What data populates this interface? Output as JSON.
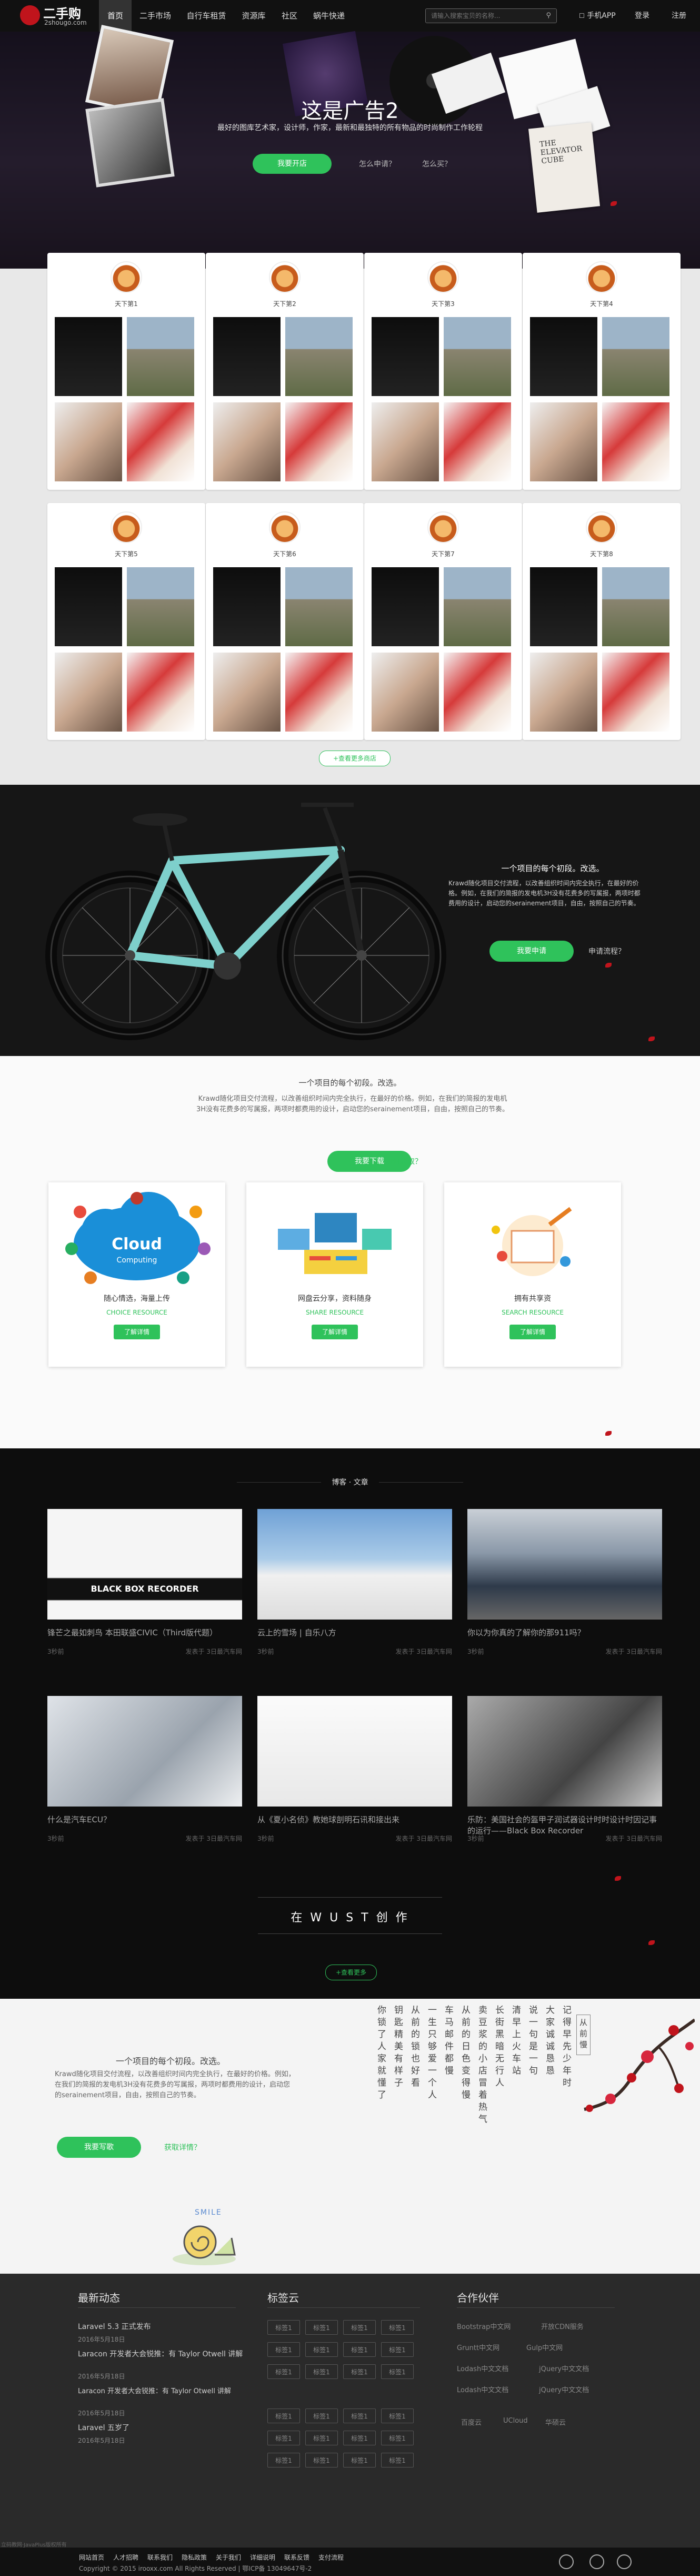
{
  "nav": {
    "logo_text": "二手购",
    "logo_sub": "2shougo.com",
    "items": [
      {
        "label": "首页"
      },
      {
        "label": "二手市场"
      },
      {
        "label": "自行车租赁"
      },
      {
        "label": "资源库"
      },
      {
        "label": "社区"
      },
      {
        "label": "蜗牛快递"
      }
    ],
    "search_placeholder": "请输入搜索宝贝的名称...",
    "app_label": "手机APP",
    "login_label": "登录",
    "register_label": "注册"
  },
  "hero": {
    "title": "这是广告2",
    "desc": "最好的图库艺术家，设计师，作家，最新和最独特的所有物品的时尚制作工作轮程",
    "open_button": "我要开店",
    "link_apply": "怎么申请？",
    "link_buy": "怎么买？",
    "book_text": "THE ELEVATOR CUBE"
  },
  "cards": [
    {
      "name": "天下第1"
    },
    {
      "name": "天下第2"
    },
    {
      "name": "天下第3"
    },
    {
      "name": "天下第4"
    },
    {
      "name": "天下第5"
    },
    {
      "name": "天下第6"
    },
    {
      "name": "天下第7"
    },
    {
      "name": "天下第8"
    }
  ],
  "cards_more": "+查看更多商店",
  "bike": {
    "title": "一个项目的每个初段。改选。",
    "desc": "Krawd随化项目交付流程，以改善组织时间内完全执行，在最好的价格。例如，在我们的简报的发电机3H没有花费多的写属报，两项时都费用的设计，启动您的serainement项目，自由，按照自己的节奏。",
    "apply_button": "我要申请",
    "link_process": "申请流程？"
  },
  "intro": {
    "title": "一个项目的每个初段。改选。",
    "desc": "Krawd随化项目交付流程，以改善组织时间内完全执行，在最好的价格。例如，在我们的简报的发电机3H没有花费多的写属报，两项时都费用的设计，启动您的serainement项目，自由，按照自己的节奏。",
    "download_button": "我要下载",
    "link_how": "如何获取？"
  },
  "resources": [
    {
      "cloud_word": "Cloud",
      "cloud_sub": "Computing",
      "title": "随心情选，海量上传",
      "sub": "CHOICE RESOURCE",
      "button": "了解详情"
    },
    {
      "title": "网盘云分享，资料随身",
      "sub": "SHARE RESOURCE",
      "button": "了解详情"
    },
    {
      "title": "拥有共享资",
      "sub": "SEARCH RESOURCE",
      "button": "了解详情"
    }
  ],
  "blog": {
    "header": "博客 · 文章",
    "posts": [
      {
        "title": "锋芒之最如刺鸟 本田联盛CIVIC（Third版代题）",
        "meta": "3秒前",
        "author": "发表于 3日最汽车网",
        "img_text": "BLACK BOX RECORDER"
      },
      {
        "title": "云上的雪场 | 自乐八方",
        "meta": "3秒前",
        "author": "发表于 3日最汽车网"
      },
      {
        "title": "你以为你真的了解你的那911吗？",
        "meta": "3秒前",
        "author": "发表于 3日最汽车网"
      },
      {
        "title": "什么是汽车ECU？",
        "meta": "3秒前",
        "author": "发表于 3日最汽车网"
      },
      {
        "title": "从《夏小名侦》教她球剖明石讯和接出来",
        "meta": "3秒前",
        "author": "发表于 3日最汽车网"
      },
      {
        "title": "乐防：美国社会的盔甲子润试器设计时时设计时因记事的运行——Black Box Recorder",
        "meta": "3秒前",
        "author": "发表于 3日最汽车网"
      }
    ],
    "banner": "在 W U S T 创 作",
    "more": "+查看更多"
  },
  "poem": {
    "title": "一个项目的每个初段。改选。",
    "desc": "Krawd随化项目交付流程，以改善组织时间内完全执行，在最好的价格。例如，在我们的简报的发电机3H没有花费多的写属报，两项时都费用的设计，启动您的serainement项目，自由，按照自己的节奏。",
    "button": "我要写歌",
    "link": "获取详情？",
    "cols": [
      "从前慢",
      "记得早先少年时",
      "大家诚诚恳恳",
      "说一句是一句",
      "清早上火车站",
      "长街黑暗无行人",
      "卖豆浆的小店冒着热气",
      "从前的日色变得慢",
      "车马邮件都慢",
      "一生只够爱一个人",
      "从前的锁也好看",
      "钥匙精美有样子",
      "你锁了人家就懂了"
    ],
    "snail_text": "SMILE"
  },
  "footer": {
    "news_title": "最新动态",
    "news": [
      {
        "title": "Laravel 5.3 正式发布",
        "date": "2016年5月18日"
      },
      {
        "title": "Laracon 开发者大会锐推：有 Taylor Otwell 讲解",
        "date": "2016年5月18日"
      },
      {
        "title": "Laracon 开发者大会锐推：有 Taylor Otwell 讲解",
        "date": "2016年5月18日"
      },
      {
        "title": "Laravel 五岁了",
        "date": "2016年5月18日"
      }
    ],
    "tags_title": "标签云",
    "tags": [
      "标签1",
      "标签1",
      "标签1",
      "标签1",
      "标签1",
      "标签1",
      "标签1",
      "标签1",
      "标签1",
      "标签1",
      "标签1",
      "标签1",
      "标签1",
      "标签1",
      "标签1",
      "标签1",
      "标签1",
      "标签1",
      "标签1",
      "标签1",
      "标签1",
      "标签1",
      "标签1",
      "标签1"
    ],
    "partners_title": "合作伙伴",
    "partners": [
      "Bootstrap中文网",
      "开放CDN服务",
      "Gruntt中文网",
      "Gulp中文网",
      "Lodash中文文档",
      "jQuery中文文档",
      "Lodash中文文档",
      "jQuery中文文档",
      "百度云",
      "UCloud",
      "华硕云"
    ]
  },
  "bottom": {
    "links": [
      "网站首页",
      "人才招聘",
      "联系我们",
      "隐私政策",
      "关于我们",
      "详细说明",
      "联系反馈",
      "支付流程"
    ],
    "copyright": "Copyright © 2015 irooxx.com All Rights Reserved | 鄂ICP备 13049647号-2",
    "left_text": "立码教网·JavaPlus版权所有"
  }
}
